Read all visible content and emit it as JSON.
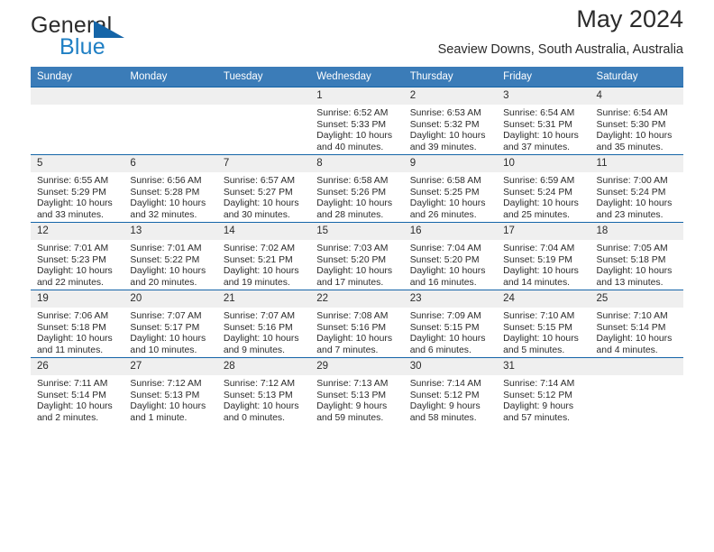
{
  "brand": {
    "word_one": "General",
    "word_two": "Blue",
    "triangle_color": "#1565a8",
    "blue_color": "#1f7fc4"
  },
  "header": {
    "month_title": "May 2024",
    "location": "Seaview Downs, South Australia, Australia"
  },
  "theme": {
    "header_bg": "#3b7cb8",
    "row_rule": "#1565a8",
    "daynum_bg": "#efefef"
  },
  "weekdays": [
    "Sunday",
    "Monday",
    "Tuesday",
    "Wednesday",
    "Thursday",
    "Friday",
    "Saturday"
  ],
  "weeks": [
    [
      {
        "day": "",
        "sunrise": "",
        "sunset": "",
        "daylight": ""
      },
      {
        "day": "",
        "sunrise": "",
        "sunset": "",
        "daylight": ""
      },
      {
        "day": "",
        "sunrise": "",
        "sunset": "",
        "daylight": ""
      },
      {
        "day": "1",
        "sunrise": "Sunrise: 6:52 AM",
        "sunset": "Sunset: 5:33 PM",
        "daylight": "Daylight: 10 hours and 40 minutes."
      },
      {
        "day": "2",
        "sunrise": "Sunrise: 6:53 AM",
        "sunset": "Sunset: 5:32 PM",
        "daylight": "Daylight: 10 hours and 39 minutes."
      },
      {
        "day": "3",
        "sunrise": "Sunrise: 6:54 AM",
        "sunset": "Sunset: 5:31 PM",
        "daylight": "Daylight: 10 hours and 37 minutes."
      },
      {
        "day": "4",
        "sunrise": "Sunrise: 6:54 AM",
        "sunset": "Sunset: 5:30 PM",
        "daylight": "Daylight: 10 hours and 35 minutes."
      }
    ],
    [
      {
        "day": "5",
        "sunrise": "Sunrise: 6:55 AM",
        "sunset": "Sunset: 5:29 PM",
        "daylight": "Daylight: 10 hours and 33 minutes."
      },
      {
        "day": "6",
        "sunrise": "Sunrise: 6:56 AM",
        "sunset": "Sunset: 5:28 PM",
        "daylight": "Daylight: 10 hours and 32 minutes."
      },
      {
        "day": "7",
        "sunrise": "Sunrise: 6:57 AM",
        "sunset": "Sunset: 5:27 PM",
        "daylight": "Daylight: 10 hours and 30 minutes."
      },
      {
        "day": "8",
        "sunrise": "Sunrise: 6:58 AM",
        "sunset": "Sunset: 5:26 PM",
        "daylight": "Daylight: 10 hours and 28 minutes."
      },
      {
        "day": "9",
        "sunrise": "Sunrise: 6:58 AM",
        "sunset": "Sunset: 5:25 PM",
        "daylight": "Daylight: 10 hours and 26 minutes."
      },
      {
        "day": "10",
        "sunrise": "Sunrise: 6:59 AM",
        "sunset": "Sunset: 5:24 PM",
        "daylight": "Daylight: 10 hours and 25 minutes."
      },
      {
        "day": "11",
        "sunrise": "Sunrise: 7:00 AM",
        "sunset": "Sunset: 5:24 PM",
        "daylight": "Daylight: 10 hours and 23 minutes."
      }
    ],
    [
      {
        "day": "12",
        "sunrise": "Sunrise: 7:01 AM",
        "sunset": "Sunset: 5:23 PM",
        "daylight": "Daylight: 10 hours and 22 minutes."
      },
      {
        "day": "13",
        "sunrise": "Sunrise: 7:01 AM",
        "sunset": "Sunset: 5:22 PM",
        "daylight": "Daylight: 10 hours and 20 minutes."
      },
      {
        "day": "14",
        "sunrise": "Sunrise: 7:02 AM",
        "sunset": "Sunset: 5:21 PM",
        "daylight": "Daylight: 10 hours and 19 minutes."
      },
      {
        "day": "15",
        "sunrise": "Sunrise: 7:03 AM",
        "sunset": "Sunset: 5:20 PM",
        "daylight": "Daylight: 10 hours and 17 minutes."
      },
      {
        "day": "16",
        "sunrise": "Sunrise: 7:04 AM",
        "sunset": "Sunset: 5:20 PM",
        "daylight": "Daylight: 10 hours and 16 minutes."
      },
      {
        "day": "17",
        "sunrise": "Sunrise: 7:04 AM",
        "sunset": "Sunset: 5:19 PM",
        "daylight": "Daylight: 10 hours and 14 minutes."
      },
      {
        "day": "18",
        "sunrise": "Sunrise: 7:05 AM",
        "sunset": "Sunset: 5:18 PM",
        "daylight": "Daylight: 10 hours and 13 minutes."
      }
    ],
    [
      {
        "day": "19",
        "sunrise": "Sunrise: 7:06 AM",
        "sunset": "Sunset: 5:18 PM",
        "daylight": "Daylight: 10 hours and 11 minutes."
      },
      {
        "day": "20",
        "sunrise": "Sunrise: 7:07 AM",
        "sunset": "Sunset: 5:17 PM",
        "daylight": "Daylight: 10 hours and 10 minutes."
      },
      {
        "day": "21",
        "sunrise": "Sunrise: 7:07 AM",
        "sunset": "Sunset: 5:16 PM",
        "daylight": "Daylight: 10 hours and 9 minutes."
      },
      {
        "day": "22",
        "sunrise": "Sunrise: 7:08 AM",
        "sunset": "Sunset: 5:16 PM",
        "daylight": "Daylight: 10 hours and 7 minutes."
      },
      {
        "day": "23",
        "sunrise": "Sunrise: 7:09 AM",
        "sunset": "Sunset: 5:15 PM",
        "daylight": "Daylight: 10 hours and 6 minutes."
      },
      {
        "day": "24",
        "sunrise": "Sunrise: 7:10 AM",
        "sunset": "Sunset: 5:15 PM",
        "daylight": "Daylight: 10 hours and 5 minutes."
      },
      {
        "day": "25",
        "sunrise": "Sunrise: 7:10 AM",
        "sunset": "Sunset: 5:14 PM",
        "daylight": "Daylight: 10 hours and 4 minutes."
      }
    ],
    [
      {
        "day": "26",
        "sunrise": "Sunrise: 7:11 AM",
        "sunset": "Sunset: 5:14 PM",
        "daylight": "Daylight: 10 hours and 2 minutes."
      },
      {
        "day": "27",
        "sunrise": "Sunrise: 7:12 AM",
        "sunset": "Sunset: 5:13 PM",
        "daylight": "Daylight: 10 hours and 1 minute."
      },
      {
        "day": "28",
        "sunrise": "Sunrise: 7:12 AM",
        "sunset": "Sunset: 5:13 PM",
        "daylight": "Daylight: 10 hours and 0 minutes."
      },
      {
        "day": "29",
        "sunrise": "Sunrise: 7:13 AM",
        "sunset": "Sunset: 5:13 PM",
        "daylight": "Daylight: 9 hours and 59 minutes."
      },
      {
        "day": "30",
        "sunrise": "Sunrise: 7:14 AM",
        "sunset": "Sunset: 5:12 PM",
        "daylight": "Daylight: 9 hours and 58 minutes."
      },
      {
        "day": "31",
        "sunrise": "Sunrise: 7:14 AM",
        "sunset": "Sunset: 5:12 PM",
        "daylight": "Daylight: 9 hours and 57 minutes."
      },
      {
        "day": "",
        "sunrise": "",
        "sunset": "",
        "daylight": ""
      }
    ]
  ]
}
